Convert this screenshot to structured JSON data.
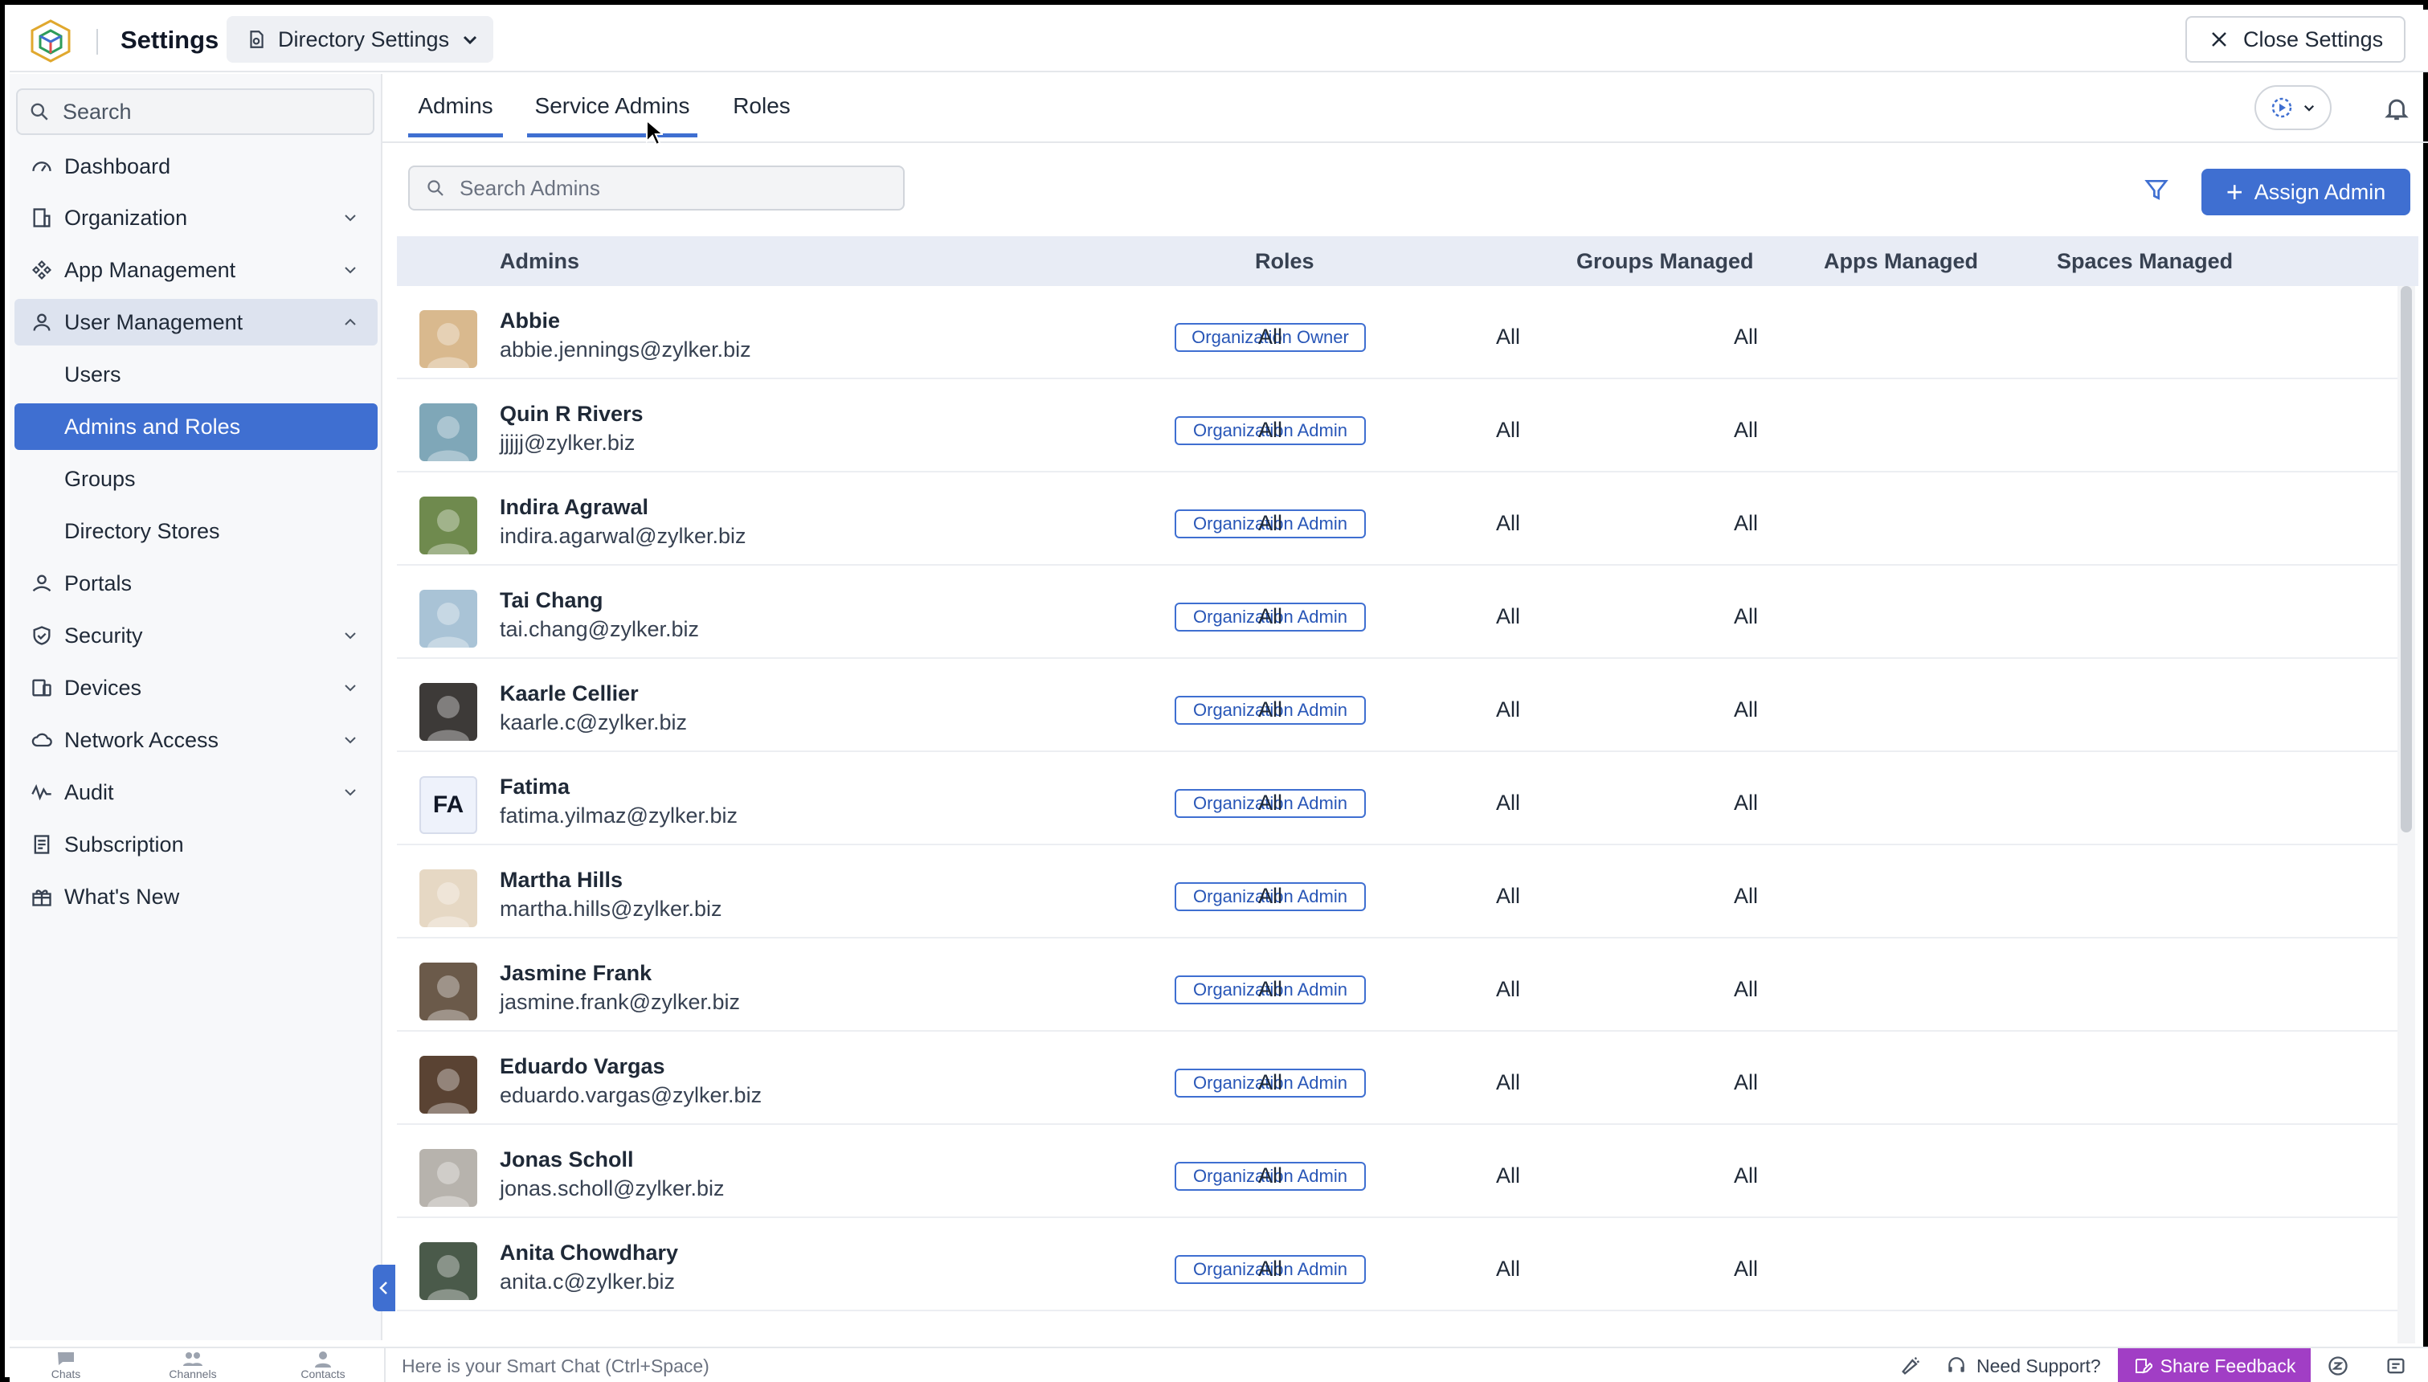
{
  "header": {
    "app_title": "Settings",
    "directory_select": "Directory Settings",
    "close_label": "Close Settings"
  },
  "sidebar": {
    "search_placeholder": "Search",
    "items": [
      {
        "label": "Dashboard",
        "icon": "dashboard-icon"
      },
      {
        "label": "Organization",
        "icon": "organization-icon",
        "chevron": "down"
      },
      {
        "label": "App Management",
        "icon": "app-management-icon",
        "chevron": "down"
      },
      {
        "label": "User Management",
        "icon": "user-icon",
        "chevron": "up",
        "expanded": true
      },
      {
        "label": "Users",
        "sub": true
      },
      {
        "label": "Admins and Roles",
        "sub": true,
        "active": true
      },
      {
        "label": "Groups",
        "sub": true
      },
      {
        "label": "Directory Stores",
        "sub": true
      },
      {
        "label": "Portals",
        "icon": "portals-icon"
      },
      {
        "label": "Security",
        "icon": "shield-icon",
        "chevron": "down"
      },
      {
        "label": "Devices",
        "icon": "devices-icon",
        "chevron": "down"
      },
      {
        "label": "Network Access",
        "icon": "cloud-icon",
        "chevron": "down"
      },
      {
        "label": "Audit",
        "icon": "audit-icon",
        "chevron": "down"
      },
      {
        "label": "Subscription",
        "icon": "subscription-icon"
      },
      {
        "label": "What's New",
        "icon": "gift-icon"
      }
    ]
  },
  "tabs": [
    {
      "label": "Admins",
      "active": true
    },
    {
      "label": "Service Admins"
    },
    {
      "label": "Roles"
    }
  ],
  "toolbar": {
    "search_placeholder": "Search Admins",
    "assign_label": "Assign Admin"
  },
  "table": {
    "columns": [
      "Admins",
      "Roles",
      "Groups Managed",
      "Apps Managed",
      "Spaces Managed"
    ],
    "rows": [
      {
        "name": "Abbie",
        "email": "abbie.jennings@zylker.biz",
        "role": "Organization Owner",
        "groups": "All",
        "apps": "All",
        "spaces": "All",
        "avatar_color": "#d9b98e"
      },
      {
        "name": "Quin R Rivers",
        "email": "jjjjj@zylker.biz",
        "role": "Organization Admin",
        "groups": "All",
        "apps": "All",
        "spaces": "All",
        "avatar_color": "#7fa7b8"
      },
      {
        "name": "Indira Agrawal",
        "email": "indira.agarwal@zylker.biz",
        "role": "Organization Admin",
        "groups": "All",
        "apps": "All",
        "spaces": "All",
        "avatar_color": "#6f8a4e"
      },
      {
        "name": "Tai Chang",
        "email": "tai.chang@zylker.biz",
        "role": "Organization Admin",
        "groups": "All",
        "apps": "All",
        "spaces": "All",
        "avatar_color": "#a9c3d6"
      },
      {
        "name": "Kaarle Cellier",
        "email": "kaarle.c@zylker.biz",
        "role": "Organization Admin",
        "groups": "All",
        "apps": "All",
        "spaces": "All",
        "avatar_color": "#3d3a38"
      },
      {
        "name": "Fatima",
        "email": "fatima.yilmaz@zylker.biz",
        "role": "Organization Admin",
        "groups": "All",
        "apps": "All",
        "spaces": "All",
        "initials": "FA"
      },
      {
        "name": "Martha Hills",
        "email": "martha.hills@zylker.biz",
        "role": "Organization Admin",
        "groups": "All",
        "apps": "All",
        "spaces": "All",
        "avatar_color": "#e6d8c4"
      },
      {
        "name": "Jasmine Frank",
        "email": "jasmine.frank@zylker.biz",
        "role": "Organization Admin",
        "groups": "All",
        "apps": "All",
        "spaces": "All",
        "avatar_color": "#6b5a4a"
      },
      {
        "name": "Eduardo Vargas",
        "email": "eduardo.vargas@zylker.biz",
        "role": "Organization Admin",
        "groups": "All",
        "apps": "All",
        "spaces": "All",
        "avatar_color": "#5a4333"
      },
      {
        "name": "Jonas Scholl",
        "email": "jonas.scholl@zylker.biz",
        "role": "Organization Admin",
        "groups": "All",
        "apps": "All",
        "spaces": "All",
        "avatar_color": "#b7b3ad"
      },
      {
        "name": "Anita Chowdhary",
        "email": "anita.c@zylker.biz",
        "role": "Organization Admin",
        "groups": "All",
        "apps": "All",
        "spaces": "All",
        "avatar_color": "#4a5a4a"
      }
    ]
  },
  "bottombar": {
    "tabs": [
      "Chats",
      "Channels",
      "Contacts"
    ],
    "smartchat_placeholder": "Here is your Smart Chat (Ctrl+Space)",
    "support_label": "Need Support?",
    "feedback_label": "Share Feedback"
  },
  "colors": {
    "accent": "#3f6fd1",
    "feedback": "#a13ec5"
  }
}
